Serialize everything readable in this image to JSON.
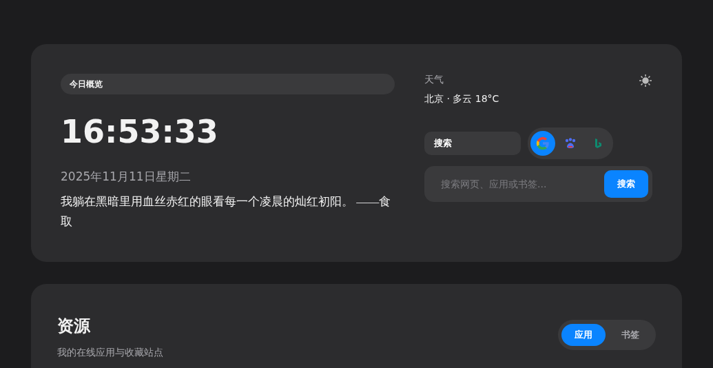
{
  "overview": {
    "badge": "今日概览",
    "time": "16:53:33",
    "date": "2025年11月11日星期二",
    "quote": "我躺在黑暗里用血丝赤红的眼看每一个凌晨的灿红初阳。 ——食取"
  },
  "weather": {
    "label": "天气",
    "summary": "北京 · 多云 18°C"
  },
  "search": {
    "mode": "搜索",
    "engines": [
      {
        "kind": "google",
        "selected": true
      },
      {
        "kind": "baidu",
        "selected": false
      },
      {
        "kind": "bing",
        "selected": false
      }
    ],
    "placeholder": "搜索网页、应用或书签...",
    "button": "搜索"
  },
  "resources": {
    "title": "资源",
    "subtitle": "我的在线应用与收藏站点",
    "tabs": [
      {
        "label": "应用",
        "selected": true
      },
      {
        "label": "书签",
        "selected": false
      }
    ]
  }
}
